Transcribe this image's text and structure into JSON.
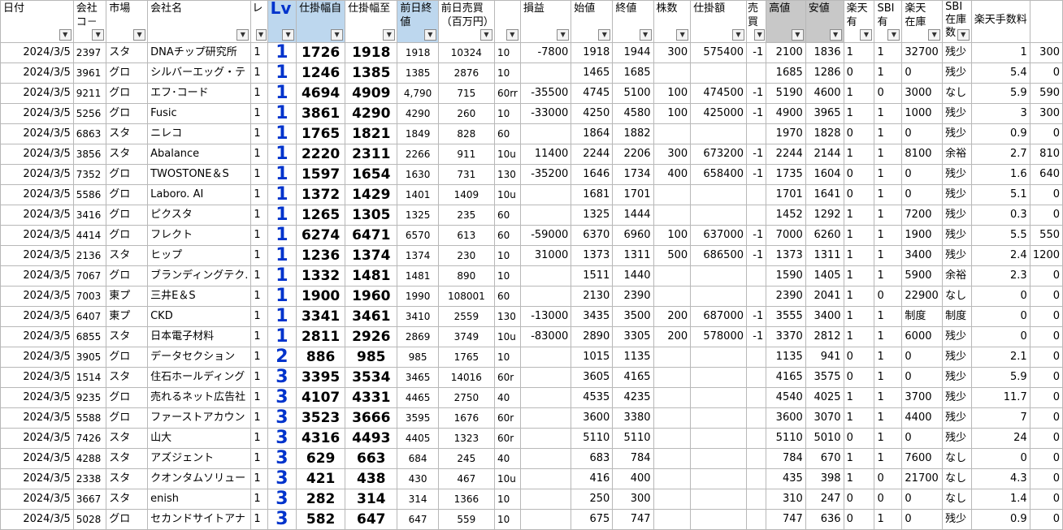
{
  "headers": {
    "date": "日付",
    "code": "会社\nコ－",
    "market": "市場",
    "name": "会社名",
    "level": "レ",
    "lv": "Lv",
    "from": "仕掛幅自",
    "to": "仕掛幅至",
    "prev_close": "前日終値",
    "prev_volume": "前日売買\n（百万円）",
    "misc": "",
    "pnl": "損益",
    "open": "始値",
    "close": "終値",
    "shares": "株数",
    "amount": "仕掛額",
    "side": "売\n買",
    "high": "高値",
    "low": "安値",
    "rakuten_avail": "楽天\n有",
    "sbi_avail": "SBI\n有",
    "rakuten_stock": "楽天\n在庫",
    "sbi_stock": "SBI\n在庫\n数",
    "fee1": "楽天手数料",
    "fee2": ""
  },
  "rows": [
    [
      "2024/3/5",
      "2397",
      "スタ",
      "DNAチップ研究所",
      "1",
      "1",
      "1726",
      "1918",
      "1918",
      "10324",
      "10",
      "-7800",
      "1918",
      "1944",
      "300",
      "575400",
      "-1",
      "2100",
      "1836",
      "1",
      "1",
      "32700",
      "残少",
      "1",
      "300"
    ],
    [
      "2024/3/5",
      "3961",
      "グロ",
      "シルバーエッグ・テ",
      "1",
      "1",
      "1246",
      "1385",
      "1385",
      "2876",
      "10",
      "",
      "1465",
      "1685",
      "",
      "",
      "",
      "1685",
      "1286",
      "0",
      "1",
      "0",
      "残少",
      "5.4",
      "0"
    ],
    [
      "2024/3/5",
      "9211",
      "グロ",
      "エフ･コード",
      "1",
      "1",
      "4694",
      "4909",
      "4,790",
      "715",
      "60rr",
      "-35500",
      "4745",
      "5100",
      "100",
      "474500",
      "-1",
      "5190",
      "4600",
      "1",
      "0",
      "3000",
      "なし",
      "5.9",
      "590"
    ],
    [
      "2024/3/5",
      "5256",
      "グロ",
      "Fusic",
      "1",
      "1",
      "3861",
      "4290",
      "4290",
      "260",
      "10",
      "-33000",
      "4250",
      "4580",
      "100",
      "425000",
      "-1",
      "4900",
      "3965",
      "1",
      "1",
      "1000",
      "残少",
      "3",
      "300"
    ],
    [
      "2024/3/5",
      "6863",
      "スタ",
      "ニレコ",
      "1",
      "1",
      "1765",
      "1821",
      "1849",
      "828",
      "60",
      "",
      "1864",
      "1882",
      "",
      "",
      "",
      "1970",
      "1828",
      "0",
      "1",
      "0",
      "残少",
      "0.9",
      "0"
    ],
    [
      "2024/3/5",
      "3856",
      "スタ",
      "Abalance",
      "1",
      "1",
      "2220",
      "2311",
      "2266",
      "911",
      "10u",
      "11400",
      "2244",
      "2206",
      "300",
      "673200",
      "-1",
      "2244",
      "2144",
      "1",
      "1",
      "8100",
      "余裕",
      "2.7",
      "810"
    ],
    [
      "2024/3/5",
      "7352",
      "グロ",
      "TWOSTONE＆S",
      "1",
      "1",
      "1597",
      "1654",
      "1630",
      "731",
      "130",
      "-35200",
      "1646",
      "1734",
      "400",
      "658400",
      "-1",
      "1735",
      "1604",
      "0",
      "1",
      "0",
      "残少",
      "1.6",
      "640"
    ],
    [
      "2024/3/5",
      "5586",
      "グロ",
      "Laboro. AI",
      "1",
      "1",
      "1372",
      "1429",
      "1401",
      "1409",
      "10u",
      "",
      "1681",
      "1701",
      "",
      "",
      "",
      "1701",
      "1641",
      "0",
      "1",
      "0",
      "残少",
      "5.1",
      "0"
    ],
    [
      "2024/3/5",
      "3416",
      "グロ",
      "ピクスタ",
      "1",
      "1",
      "1265",
      "1305",
      "1325",
      "235",
      "60",
      "",
      "1325",
      "1444",
      "",
      "",
      "",
      "1452",
      "1292",
      "1",
      "1",
      "7200",
      "残少",
      "0.3",
      "0"
    ],
    [
      "2024/3/5",
      "4414",
      "グロ",
      "フレクト",
      "1",
      "1",
      "6274",
      "6471",
      "6570",
      "613",
      "60",
      "-59000",
      "6370",
      "6960",
      "100",
      "637000",
      "-1",
      "7000",
      "6260",
      "1",
      "1",
      "1900",
      "残少",
      "5.5",
      "550"
    ],
    [
      "2024/3/5",
      "2136",
      "スタ",
      "ヒップ",
      "1",
      "1",
      "1236",
      "1374",
      "1374",
      "230",
      "10",
      "31000",
      "1373",
      "1311",
      "500",
      "686500",
      "-1",
      "1373",
      "1311",
      "1",
      "1",
      "3400",
      "残少",
      "2.4",
      "1200"
    ],
    [
      "2024/3/5",
      "7067",
      "グロ",
      "ブランディングテク.",
      "1",
      "1",
      "1332",
      "1481",
      "1481",
      "890",
      "10",
      "",
      "1511",
      "1440",
      "",
      "",
      "",
      "1590",
      "1405",
      "1",
      "1",
      "5900",
      "余裕",
      "2.3",
      "0"
    ],
    [
      "2024/3/5",
      "7003",
      "東プ",
      "三井E＆S",
      "1",
      "1",
      "1900",
      "1960",
      "1990",
      "108001",
      "60",
      "",
      "2130",
      "2390",
      "",
      "",
      "",
      "2390",
      "2041",
      "1",
      "0",
      "22900",
      "なし",
      "0",
      "0"
    ],
    [
      "2024/3/5",
      "6407",
      "東プ",
      "CKD",
      "1",
      "1",
      "3341",
      "3461",
      "3410",
      "2559",
      "130",
      "-13000",
      "3435",
      "3500",
      "200",
      "687000",
      "-1",
      "3555",
      "3400",
      "1",
      "1",
      "制度",
      "制度",
      "0",
      "0"
    ],
    [
      "2024/3/5",
      "6855",
      "スタ",
      "日本電子材料",
      "1",
      "1",
      "2811",
      "2926",
      "2869",
      "3749",
      "10u",
      "-83000",
      "2890",
      "3305",
      "200",
      "578000",
      "-1",
      "3370",
      "2812",
      "1",
      "1",
      "6000",
      "残少",
      "0",
      "0"
    ],
    [
      "2024/3/5",
      "3905",
      "グロ",
      "データセクション",
      "1",
      "2",
      "886",
      "985",
      "985",
      "1765",
      "10",
      "",
      "1015",
      "1135",
      "",
      "",
      "",
      "1135",
      "941",
      "0",
      "1",
      "0",
      "残少",
      "2.1",
      "0"
    ],
    [
      "2024/3/5",
      "1514",
      "スタ",
      "住石ホールディング",
      "1",
      "3",
      "3395",
      "3534",
      "3465",
      "14016",
      "60r",
      "",
      "3605",
      "4165",
      "",
      "",
      "",
      "4165",
      "3575",
      "0",
      "1",
      "0",
      "残少",
      "5.9",
      "0"
    ],
    [
      "2024/3/5",
      "9235",
      "グロ",
      "売れるネット広告社",
      "1",
      "3",
      "4107",
      "4331",
      "4465",
      "2750",
      "40",
      "",
      "4535",
      "4235",
      "",
      "",
      "",
      "4540",
      "4025",
      "1",
      "1",
      "3700",
      "残少",
      "11.7",
      "0"
    ],
    [
      "2024/3/5",
      "5588",
      "グロ",
      "ファーストアカウン",
      "1",
      "3",
      "3523",
      "3666",
      "3595",
      "1676",
      "60r",
      "",
      "3600",
      "3380",
      "",
      "",
      "",
      "3600",
      "3070",
      "1",
      "1",
      "4400",
      "残少",
      "7",
      "0"
    ],
    [
      "2024/3/5",
      "7426",
      "スタ",
      "山大",
      "1",
      "3",
      "4316",
      "4493",
      "4405",
      "1323",
      "60r",
      "",
      "5110",
      "5110",
      "",
      "",
      "",
      "5110",
      "5010",
      "0",
      "1",
      "0",
      "残少",
      "24",
      "0"
    ],
    [
      "2024/3/5",
      "4288",
      "スタ",
      "アズジェント",
      "1",
      "3",
      "629",
      "663",
      "684",
      "245",
      "40",
      "",
      "683",
      "784",
      "",
      "",
      "",
      "784",
      "670",
      "1",
      "1",
      "7600",
      "なし",
      "0",
      "0"
    ],
    [
      "2024/3/5",
      "2338",
      "スタ",
      "クオンタムソリュー",
      "1",
      "3",
      "421",
      "438",
      "430",
      "467",
      "10u",
      "",
      "416",
      "400",
      "",
      "",
      "",
      "435",
      "398",
      "1",
      "0",
      "21700",
      "なし",
      "4.3",
      "0"
    ],
    [
      "2024/3/5",
      "3667",
      "スタ",
      "enish",
      "1",
      "3",
      "282",
      "314",
      "314",
      "1366",
      "10",
      "",
      "250",
      "300",
      "",
      "",
      "",
      "310",
      "247",
      "0",
      "0",
      "0",
      "なし",
      "1.4",
      "0"
    ],
    [
      "2024/3/5",
      "5028",
      "グロ",
      "セカンドサイトアナ",
      "1",
      "3",
      "582",
      "647",
      "647",
      "559",
      "10",
      "",
      "675",
      "747",
      "",
      "",
      "",
      "747",
      "636",
      "0",
      "1",
      "0",
      "残少",
      "0.9",
      "0"
    ]
  ]
}
